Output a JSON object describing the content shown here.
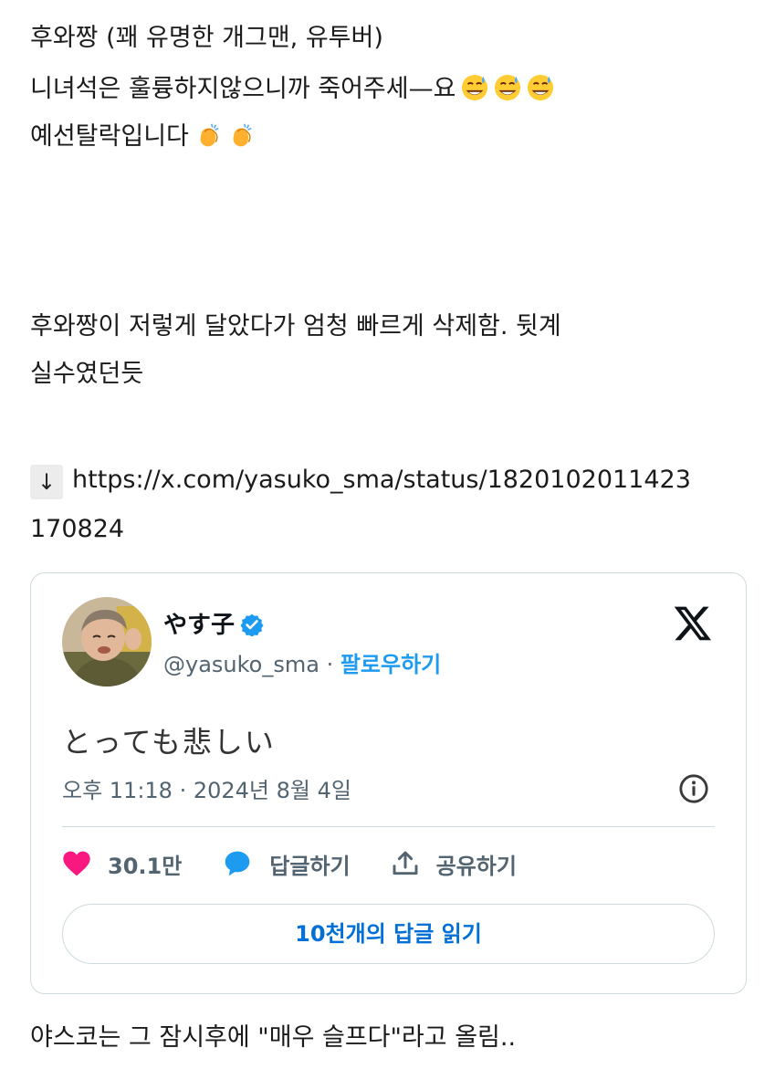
{
  "post": {
    "line1": "후와짱 (꽤 유명한 개그맨, 유투버)",
    "line2": "니녀석은 훌륭하지않으니까 죽어주세—요",
    "line3": "예선탈락입니다",
    "line4": "후와짱이 저렇게 달았다가 엄청 빠르게 삭제함. 뒷계",
    "line5": "실수였던듯",
    "arrow": "↓",
    "link_part1": "https://x.com/yasuko_sma/status/1820102011423",
    "link_part2": "170824",
    "line8": "야스코는 그 잠시후에 \"매우 슬프다\"라고 올림.."
  },
  "icons": {
    "sweat_smile": "sweat-smile-emoji",
    "clap": "clapping-hands-emoji",
    "verified": "verified-badge-icon",
    "x_logo": "x-logo-icon",
    "info": "info-icon",
    "heart": "heart-icon",
    "reply": "reply-bubble-icon",
    "share": "share-icon"
  },
  "tweet": {
    "display_name": "やす子",
    "handle": "@yasuko_sma",
    "separator": " · ",
    "follow_label": "팔로우하기",
    "text": "とっても悲しい",
    "timestamp": "오후 11:18 · 2024년 8월 4일",
    "likes": "30.1만",
    "reply_label": "답글하기",
    "share_label": "공유하기",
    "read_replies_label": "10천개의 답글 읽기"
  },
  "colors": {
    "accent_blue": "#1d9bf0",
    "link_blue": "#006fd6",
    "heart_red": "#f91880",
    "muted_gray": "#536471",
    "border": "#cfd9de"
  }
}
